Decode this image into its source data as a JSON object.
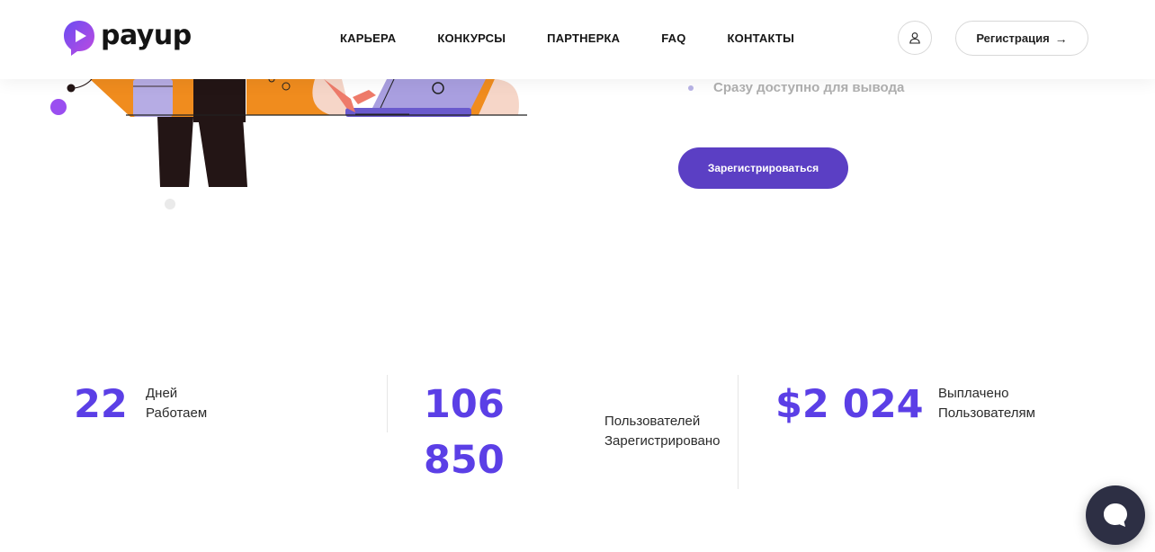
{
  "header": {
    "logo_text": "payup",
    "nav": [
      "КАРЬЕРА",
      "КОНКУРСЫ",
      "ПАРТНЕРКА",
      "FAQ",
      "КОНТАКТЫ"
    ],
    "register_label": "Регистрация",
    "register_arrow": "→"
  },
  "hero": {
    "bullet": "Сразу доступно для вывода",
    "cta_label": "Зарегистрироваться"
  },
  "stats": [
    {
      "number": "22",
      "label_line1": "Дней",
      "label_line2": "Работаем"
    },
    {
      "number_line1": "106",
      "number_line2": "850",
      "label_line1": "Пользователей",
      "label_line2": "Зарегистрировано"
    },
    {
      "number": "$2 024",
      "label_line1": "Выплачено",
      "label_line2": "Пользователям"
    }
  ],
  "colors": {
    "accent": "#5b3fe6",
    "cta": "#5b3fc4",
    "chat": "#2d2f44",
    "logo_gradient_start": "#6a4cf2",
    "logo_gradient_end": "#c04be0"
  },
  "icons": {
    "logo": "play-bubble-icon",
    "user": "user-icon",
    "chat": "chat-bubble-icon"
  }
}
